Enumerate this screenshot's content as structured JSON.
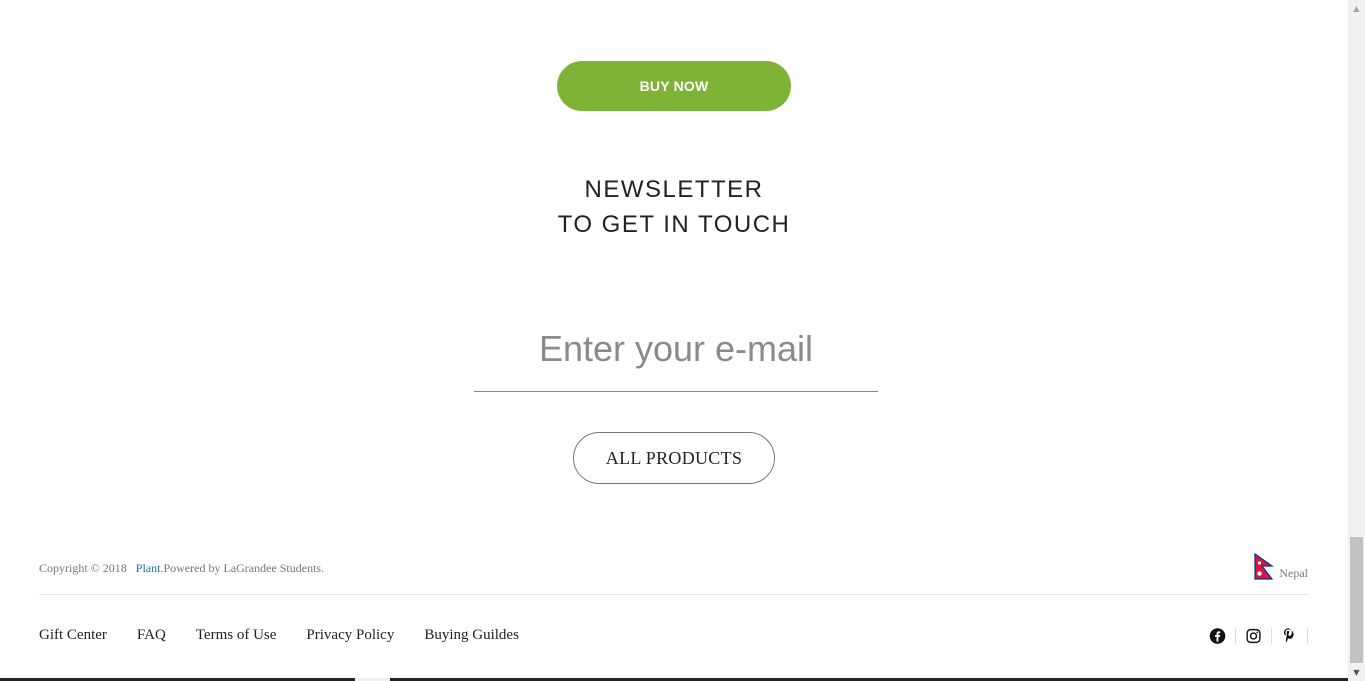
{
  "cta": {
    "buy_now_label": "BUY NOW"
  },
  "newsletter": {
    "line1": "NEWSLETTER",
    "line2": "TO GET IN TOUCH",
    "email_placeholder": "Enter your e-mail",
    "email_value": ""
  },
  "products": {
    "all_products_label": "ALL PRODUCTS"
  },
  "footer": {
    "copyright_prefix": "Copyright © 2018",
    "brand": "Plant.",
    "powered_by": "Powered by LaGrandee Students.",
    "region": "Nepal",
    "links": [
      {
        "label": "Gift Center"
      },
      {
        "label": "FAQ"
      },
      {
        "label": "Terms of Use"
      },
      {
        "label": "Privacy Policy"
      },
      {
        "label": "Buying Guildes"
      }
    ],
    "social": [
      {
        "icon": "facebook-icon"
      },
      {
        "icon": "instagram-icon"
      },
      {
        "icon": "pinterest-icon"
      }
    ]
  },
  "colors": {
    "accent_green": "#7fb338",
    "brand_link": "#1e6fb0",
    "flag_crimson": "#dc143c",
    "flag_border": "#003893"
  },
  "scrollbar": {
    "position": "bottom"
  }
}
